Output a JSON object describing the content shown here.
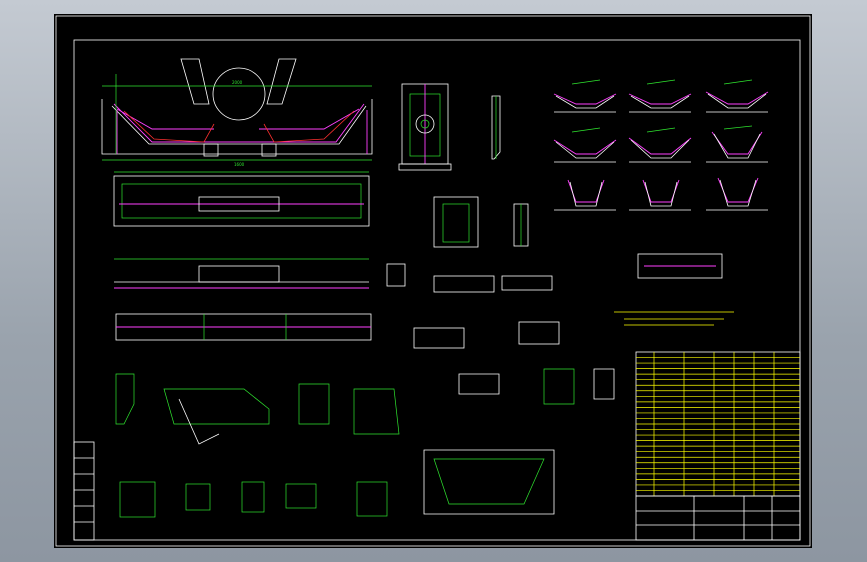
{
  "drawing": {
    "title_cn": "",
    "section_labels": []
  },
  "colors": {
    "background": "#000000",
    "frame": "#ffffff",
    "dimension": "#2fe62f",
    "belt": "#ff40ff",
    "table_text": "#ffff00",
    "desktop": "#a9b1bb"
  },
  "parts_list": {
    "rows": 26
  },
  "idler_variants": {
    "count": 9
  }
}
